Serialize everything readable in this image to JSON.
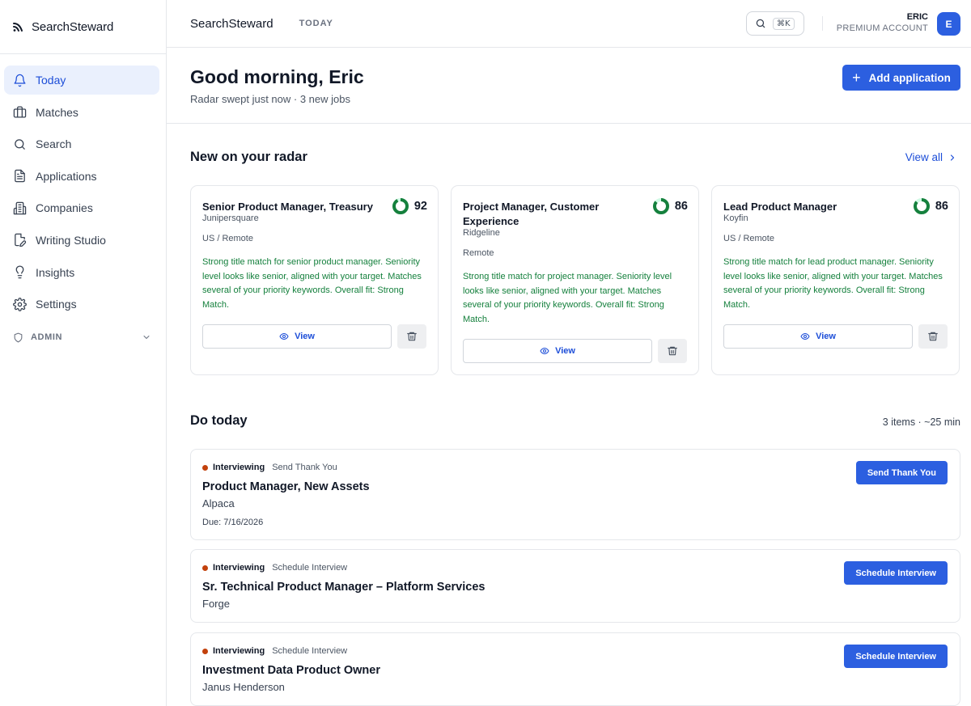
{
  "app": {
    "name": "SearchSteward"
  },
  "sidebar": {
    "items": [
      {
        "label": "Today",
        "icon": "bell-icon",
        "active": true
      },
      {
        "label": "Matches",
        "icon": "briefcase-icon"
      },
      {
        "label": "Search",
        "icon": "search-icon"
      },
      {
        "label": "Applications",
        "icon": "document-icon"
      },
      {
        "label": "Companies",
        "icon": "building-icon"
      },
      {
        "label": "Writing Studio",
        "icon": "pen-document-icon"
      },
      {
        "label": "Insights",
        "icon": "lightbulb-icon"
      },
      {
        "label": "Settings",
        "icon": "gear-icon"
      }
    ],
    "admin_label": "ADMIN"
  },
  "header": {
    "title": "SearchSteward",
    "crumb": "TODAY",
    "shortcut": "⌘K",
    "user_name": "ERIC",
    "user_plan": "PREMIUM ACCOUNT",
    "avatar_initial": "E"
  },
  "greeting": {
    "title": "Good morning, Eric",
    "subtitle": "Radar swept just now · 3 new jobs",
    "add_button": "Add application"
  },
  "radar": {
    "title": "New on your radar",
    "view_all": "View all",
    "view_label": "View",
    "cards": [
      {
        "title": "Senior Product Manager, Treasury",
        "company": "Junipersquare",
        "location": "US / Remote",
        "score": "92",
        "score_fraction": 0.92,
        "description": "Strong title match for senior product manager. Seniority level looks like senior, aligned with your target. Matches several of your priority keywords. Overall fit: Strong Match."
      },
      {
        "title": "Project Manager, Customer Experience",
        "company": "Ridgeline",
        "location": "Remote",
        "score": "86",
        "score_fraction": 0.86,
        "description": "Strong title match for project manager. Seniority level looks like senior, aligned with your target. Matches several of your priority keywords. Overall fit: Strong Match."
      },
      {
        "title": "Lead Product Manager",
        "company": "Koyfin",
        "location": "US / Remote",
        "score": "86",
        "score_fraction": 0.86,
        "description": "Strong title match for lead product manager. Seniority level looks like senior, aligned with your target. Matches several of your priority keywords. Overall fit: Strong Match."
      }
    ]
  },
  "do_today": {
    "title": "Do today",
    "meta": "3 items · ~25 min",
    "tasks": [
      {
        "stage": "Interviewing",
        "action": "Send Thank You",
        "title": "Product Manager, New Assets",
        "company": "Alpaca",
        "due": "Due: 7/16/2026",
        "button": "Send Thank You"
      },
      {
        "stage": "Interviewing",
        "action": "Schedule Interview",
        "title": "Sr. Technical Product Manager – Platform Services",
        "company": "Forge",
        "button": "Schedule Interview"
      },
      {
        "stage": "Interviewing",
        "action": "Schedule Interview",
        "title": "Investment Data Product Owner",
        "company": "Janus Henderson",
        "button": "Schedule Interview"
      }
    ]
  },
  "colors": {
    "accent": "#2c5fe0",
    "match_green": "#15803d",
    "stage_dot": "#c2410c"
  }
}
